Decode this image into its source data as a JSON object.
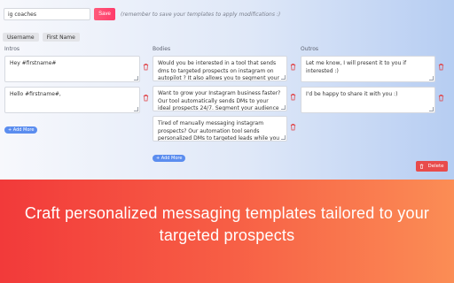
{
  "topbar": {
    "search_value": "ig coaches",
    "save_label": "Save",
    "hint": "(remember to save your templates to apply modifications :)"
  },
  "chips": [
    "Username",
    "First Name"
  ],
  "intros": {
    "label": "Intros",
    "items": [
      "Hey #firstname#",
      "Hello #firstname#,"
    ],
    "add_label": "+ Add More"
  },
  "bodies": {
    "label": "Bodies",
    "items": [
      "Would you be interested in a tool that sends dms to targeted prospects on instagram on autopilot ? It also allows you to segment your prospects and you can use personalized templates.",
      "Want to grow your Instagram business faster? Our tool automatically sends DMs to your ideal prospects 24/7. Segment your audience by interests, location, engagement level, then run targeted follow-ups.",
      "Tired of manually messaging instagram prospects? Our automation tool sends personalized DMs to targeted leads while you focus on closing deals. Segment your audience precisely, track who replied."
    ],
    "add_label": "+ Add More"
  },
  "outros": {
    "label": "Outros",
    "items": [
      "Let me know, I will present it to you if interested :)",
      "I'd be happy to share it with you :)"
    ]
  },
  "delete_label": "Delete",
  "headline": "Craft personalized messaging templates tailored to your targeted prospects",
  "colors": {
    "accent": "#5b8def",
    "save": "#ff4b70",
    "delete": "#e84b4b",
    "trash": "#e0464a"
  }
}
